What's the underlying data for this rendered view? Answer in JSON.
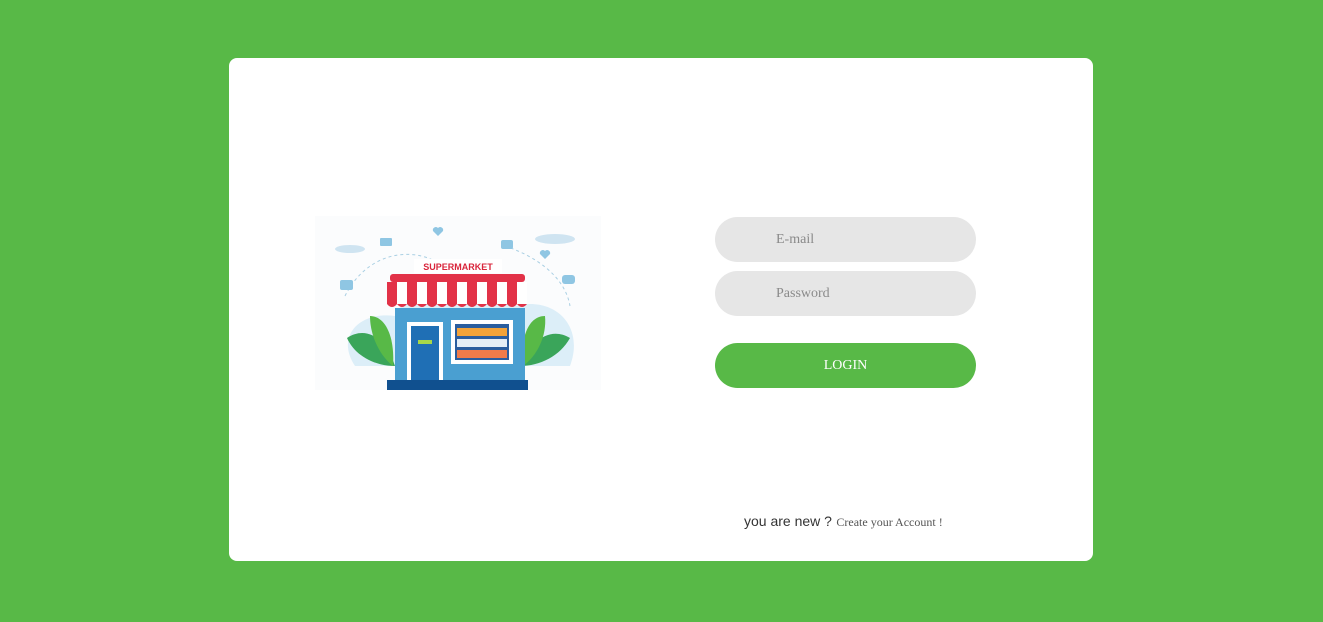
{
  "login": {
    "illustration": {
      "sign_text": "SUPERMARKET",
      "icon": "supermarket-storefront-illustration"
    },
    "email": {
      "placeholder": "E-mail",
      "value": ""
    },
    "password": {
      "placeholder": "Password",
      "value": ""
    },
    "submit_label": "LOGIN",
    "signup_prompt": "you are new ?",
    "signup_link": "Create your Account !"
  },
  "colors": {
    "background": "#58b947",
    "card": "#ffffff",
    "field": "#e6e6e6",
    "button": "#58b947"
  }
}
